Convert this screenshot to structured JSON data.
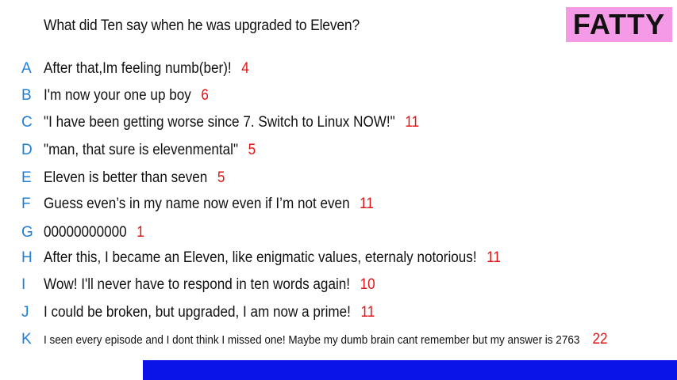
{
  "question": "What did Ten say when he was upgraded to Eleven?",
  "badge": {
    "label": "FATTY",
    "color": "#f59ae6"
  },
  "colors": {
    "letter": "#1f7fd6",
    "count": "#e01414",
    "bottom_bar": "#0a14e8"
  },
  "answers": [
    {
      "letter": "A",
      "text": "After that,Im feeling numb(ber)!",
      "count": "4"
    },
    {
      "letter": "B",
      "text": "I'm now your one up boy",
      "count": "6"
    },
    {
      "letter": "C",
      "text": "\"I have been getting worse since 7. Switch to Linux NOW!\"",
      "count": "11"
    },
    {
      "letter": "D",
      "text": "\"man, that sure is elevenmental\"",
      "count": "5"
    },
    {
      "letter": "E",
      "text": "Eleven is better than seven",
      "count": "5"
    },
    {
      "letter": "F",
      "text": "Guess even’s in my name now even if I’m not even",
      "count": "11"
    },
    {
      "letter": "G",
      "text": "00000000000",
      "count": "1"
    },
    {
      "letter": "H",
      "text": "After this, I became an Eleven, like enigmatic values, eternaly notorious!",
      "count": "11"
    },
    {
      "letter": "I",
      "text": "Wow! I'll never have to respond in ten words again!",
      "count": "10"
    },
    {
      "letter": "J",
      "text": "I could be broken, but upgraded, I am now a prime!",
      "count": "11"
    },
    {
      "letter": "K",
      "text": "I seen every episode and I dont think I missed one! Maybe my dumb brain cant remember but my answer is 2763",
      "count": "22"
    }
  ]
}
